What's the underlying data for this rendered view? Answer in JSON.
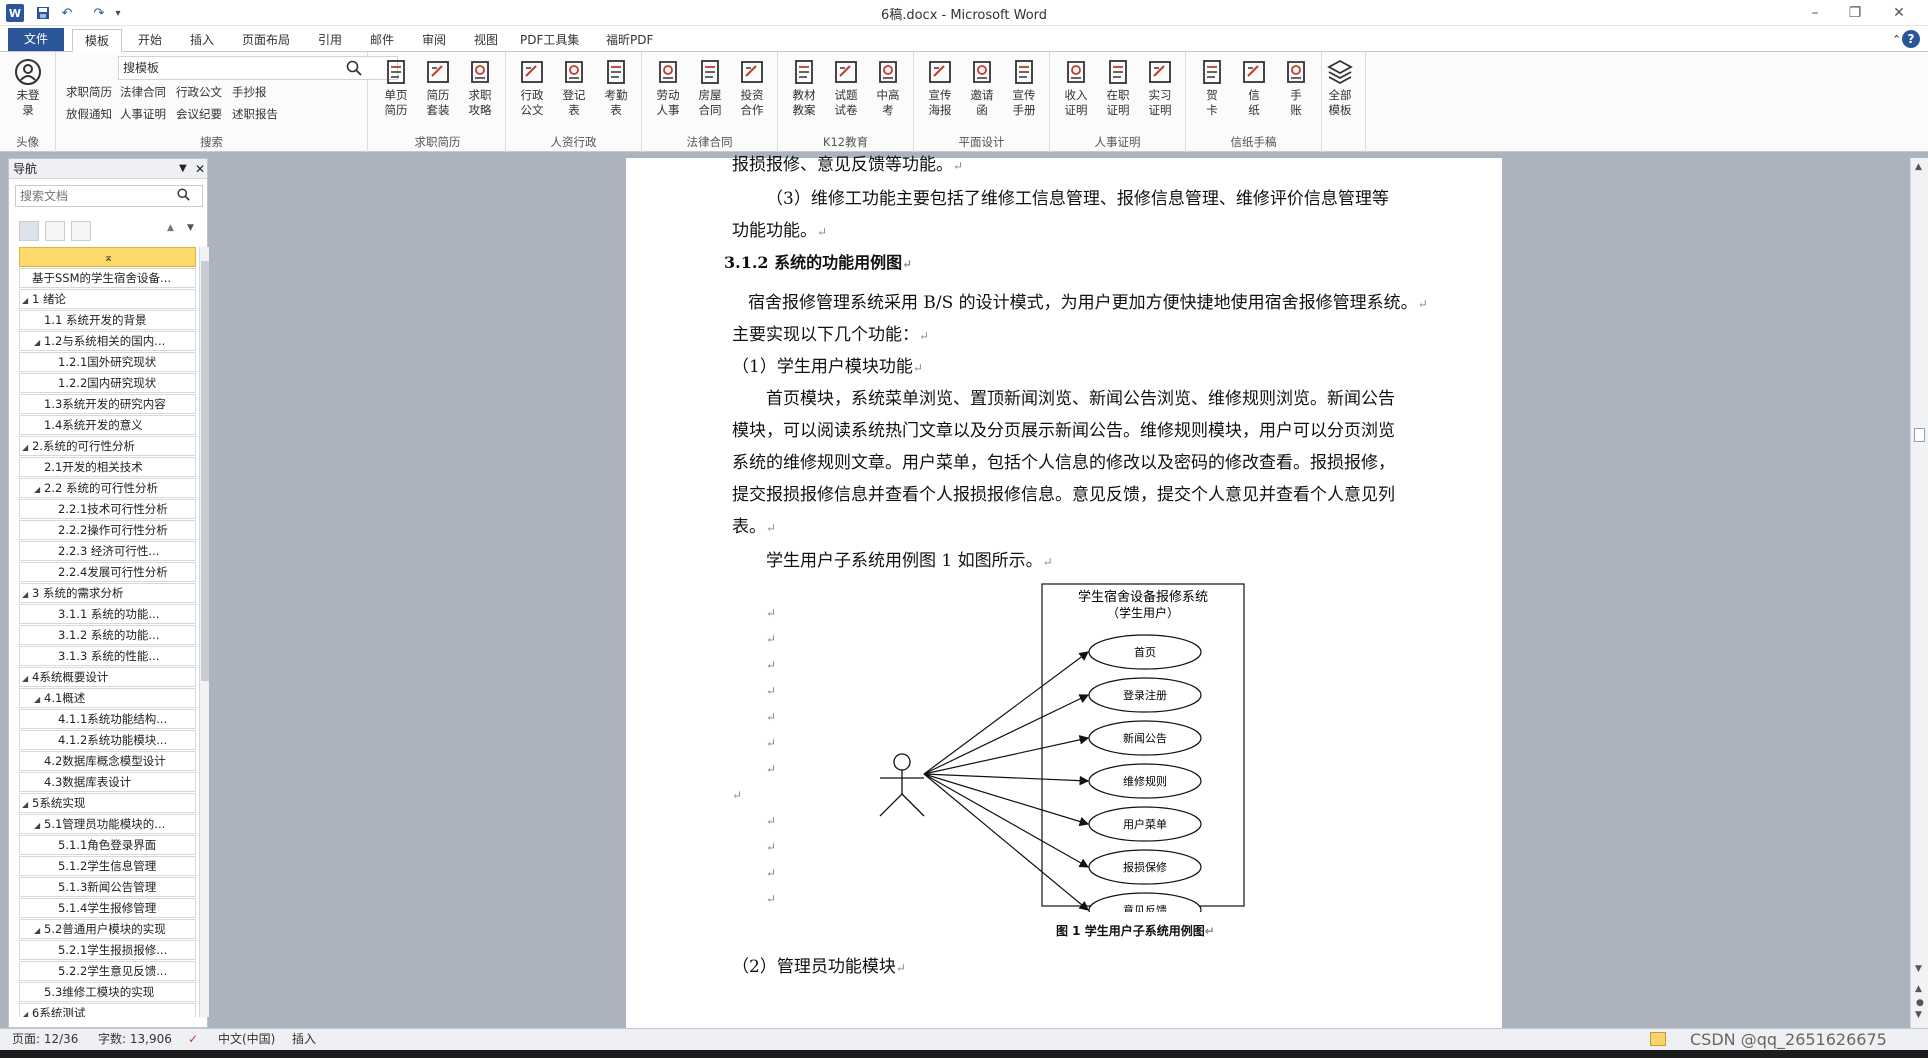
{
  "window": {
    "title": "6稿.docx - Microsoft Word",
    "word_logo": "W",
    "quick_undo": "↶",
    "quick_redo": "↷"
  },
  "tabs": [
    {
      "label": "文件"
    },
    {
      "label": "模板"
    },
    {
      "label": "开始"
    },
    {
      "label": "插入"
    },
    {
      "label": "页面布局"
    },
    {
      "label": "引用"
    },
    {
      "label": "邮件"
    },
    {
      "label": "审阅"
    },
    {
      "label": "视图"
    },
    {
      "label": "PDF工具集"
    },
    {
      "label": "福昕PDF"
    }
  ],
  "ribbon": {
    "account": {
      "label": "未登\n录",
      "group": "头像"
    },
    "search": {
      "value": "搜模板",
      "links": [
        "求职简历",
        "法律合同",
        "行政公文",
        "手抄报",
        "放假通知",
        "人事证明",
        "会议纪要",
        "述职报告"
      ],
      "group": "搜索"
    },
    "groups": [
      {
        "label": "求职简历",
        "buttons": [
          "单页\n简历",
          "简历\n套装",
          "求职\n攻略"
        ]
      },
      {
        "label": "人资行政",
        "buttons": [
          "行政\n公文",
          "登记\n表",
          "考勤\n表"
        ]
      },
      {
        "label": "法律合同",
        "buttons": [
          "劳动\n人事",
          "房屋\n合同",
          "投资\n合作"
        ]
      },
      {
        "label": "K12教育",
        "buttons": [
          "教材\n教案",
          "试题\n试卷",
          "中高\n考"
        ]
      },
      {
        "label": "平面设计",
        "buttons": [
          "宣传\n海报",
          "邀请\n函",
          "宣传\n手册"
        ]
      },
      {
        "label": "人事证明",
        "buttons": [
          "收入\n证明",
          "在职\n证明",
          "实习\n证明"
        ]
      },
      {
        "label": "信纸手稿",
        "buttons": [
          "贺\n卡",
          "信\n纸",
          "手\n账"
        ]
      }
    ],
    "all_templates": "全部\n模板"
  },
  "nav": {
    "title": "导航",
    "search_placeholder": "搜索文档",
    "items": [
      {
        "level": 0,
        "text": "",
        "selected": true
      },
      {
        "level": 1,
        "text": "基于SSM的学生宿舍设备..."
      },
      {
        "level": 1,
        "text": "1 绪论",
        "expand": true
      },
      {
        "level": 2,
        "text": "1.1 系统开发的背景"
      },
      {
        "level": 2,
        "text": "1.2与系统相关的国内...",
        "expand": true
      },
      {
        "level": 3,
        "text": "1.2.1国外研究现状"
      },
      {
        "level": 3,
        "text": "1.2.2国内研究现状"
      },
      {
        "level": 2,
        "text": "1.3系统开发的研究内容"
      },
      {
        "level": 2,
        "text": "1.4系统开发的意义"
      },
      {
        "level": 1,
        "text": "2.系统的可行性分析",
        "expand": true
      },
      {
        "level": 2,
        "text": "2.1开发的相关技术"
      },
      {
        "level": 2,
        "text": "2.2 系统的可行性分析",
        "expand": true
      },
      {
        "level": 3,
        "text": "2.2.1技术可行性分析"
      },
      {
        "level": 3,
        "text": "2.2.2操作可行性分析"
      },
      {
        "level": 3,
        "text": "2.2.3 经济可行性..."
      },
      {
        "level": 3,
        "text": "2.2.4发展可行性分析"
      },
      {
        "level": 1,
        "text": "3 系统的需求分析",
        "expand": true
      },
      {
        "level": 3,
        "text": "3.1.1 系统的功能..."
      },
      {
        "level": 3,
        "text": "3.1.2 系统的功能..."
      },
      {
        "level": 3,
        "text": "3.1.3 系统的性能..."
      },
      {
        "level": 1,
        "text": "4系统概要设计",
        "expand": true
      },
      {
        "level": 2,
        "text": "4.1概述",
        "expand": true
      },
      {
        "level": 3,
        "text": "4.1.1系统功能结构..."
      },
      {
        "level": 3,
        "text": "4.1.2系统功能模块..."
      },
      {
        "level": 2,
        "text": "4.2数据库概念模型设计"
      },
      {
        "level": 2,
        "text": "4.3数据库表设计"
      },
      {
        "level": 1,
        "text": "5系统实现",
        "expand": true
      },
      {
        "level": 2,
        "text": "5.1管理员功能模块的...",
        "expand": true
      },
      {
        "level": 3,
        "text": "5.1.1角色登录界面"
      },
      {
        "level": 3,
        "text": "5.1.2学生信息管理"
      },
      {
        "level": 3,
        "text": "5.1.3新闻公告管理"
      },
      {
        "level": 3,
        "text": "5.1.4学生报修管理"
      },
      {
        "level": 2,
        "text": "5.2普通用户模块的实现",
        "expand": true
      },
      {
        "level": 3,
        "text": "5.2.1学生报损报修..."
      },
      {
        "level": 3,
        "text": "5.2.2学生意见反馈..."
      },
      {
        "level": 2,
        "text": "5.3维修工模块的实现"
      },
      {
        "level": 1,
        "text": "6系统测试",
        "expand": true
      }
    ]
  },
  "doc": {
    "line0": "报损报修、意见反馈等功能。",
    "line1": "（3）维修工功能主要包括了维修工信息管理、报修信息管理、维修评价信息管理等",
    "line2": "功能功能。",
    "heading": "3.1.2  系统的功能用例图",
    "para1a": "宿舍报修管理系统采用 B/S 的设计模式，为用户更加方便快捷地使用宿舍报修管理系统。",
    "para1b": "主要实现以下几个功能：",
    "para2": "（1）学生用户模块功能",
    "para3a": "首页模块，系统菜单浏览、置顶新闻浏览、新闻公告浏览、维修规则浏览。新闻公告",
    "para3b": "模块，可以阅读系统热门文章以及分页展示新闻公告。维修规则模块，用户可以分页浏览",
    "para3c": "系统的维修规则文章。用户菜单，包括个人信息的修改以及密码的修改查看。报损报修，",
    "para3d": "提交报损报修信息并查看个人报损报修信息。意见反馈，提交个人意见并查看个人意见列",
    "para3e": "表。",
    "para4": "学生用户子系统用例图 1 如图所示。",
    "para5": "（2）管理员功能模块",
    "para_mark": "↵",
    "diagram": {
      "title1": "学生宿舍设备报修系统",
      "title2": "（学生用户）",
      "usecases": [
        "首页",
        "登录注册",
        "新闻公告",
        "维修规则",
        "用户菜单",
        "报损保修",
        "意见反馈"
      ],
      "caption": "图 1  学生用户子系统用例图"
    }
  },
  "status": {
    "page": "页面: 12/36",
    "words": "字数: 13,906",
    "lang": "中文(中国)",
    "mode": "插入",
    "watermark": "CSDN @qq_2651626675"
  }
}
